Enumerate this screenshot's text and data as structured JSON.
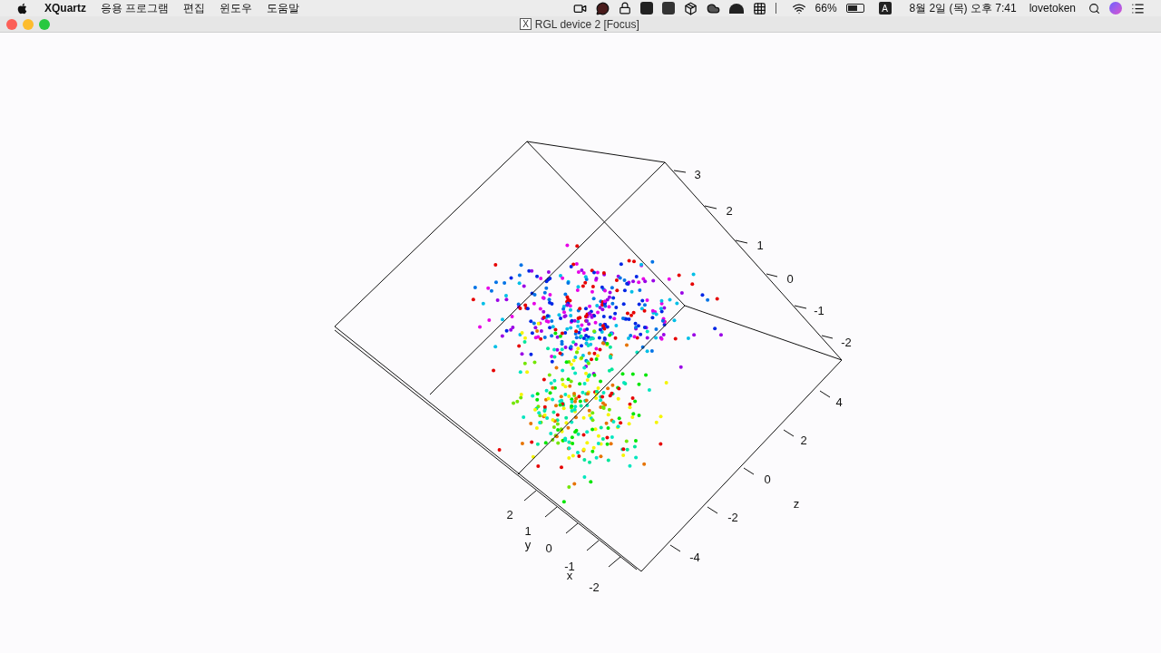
{
  "menubar": {
    "app_name": "XQuartz",
    "menus": [
      "응용 프로그램",
      "편집",
      "윈도우",
      "도움말"
    ],
    "battery_percent": "66%",
    "input_source": "A",
    "clock": "8월 2일 (목) 오후 7:41",
    "user": "lovetoken"
  },
  "window": {
    "title": "RGL device 2 [Focus]",
    "title_icon": "X"
  },
  "plot": {
    "axes": [
      {
        "kind": "upper",
        "ticks": [
          "3",
          "2",
          "1",
          "0",
          "-1",
          "-2"
        ]
      },
      {
        "kind": "right",
        "ticks": [
          "4",
          "2",
          "0",
          "-2",
          "-4"
        ],
        "label": "z"
      },
      {
        "kind": "left",
        "ticks": [
          "2",
          "1",
          "0",
          "-1",
          "-2"
        ],
        "labels": [
          "y",
          "x"
        ]
      }
    ]
  }
}
